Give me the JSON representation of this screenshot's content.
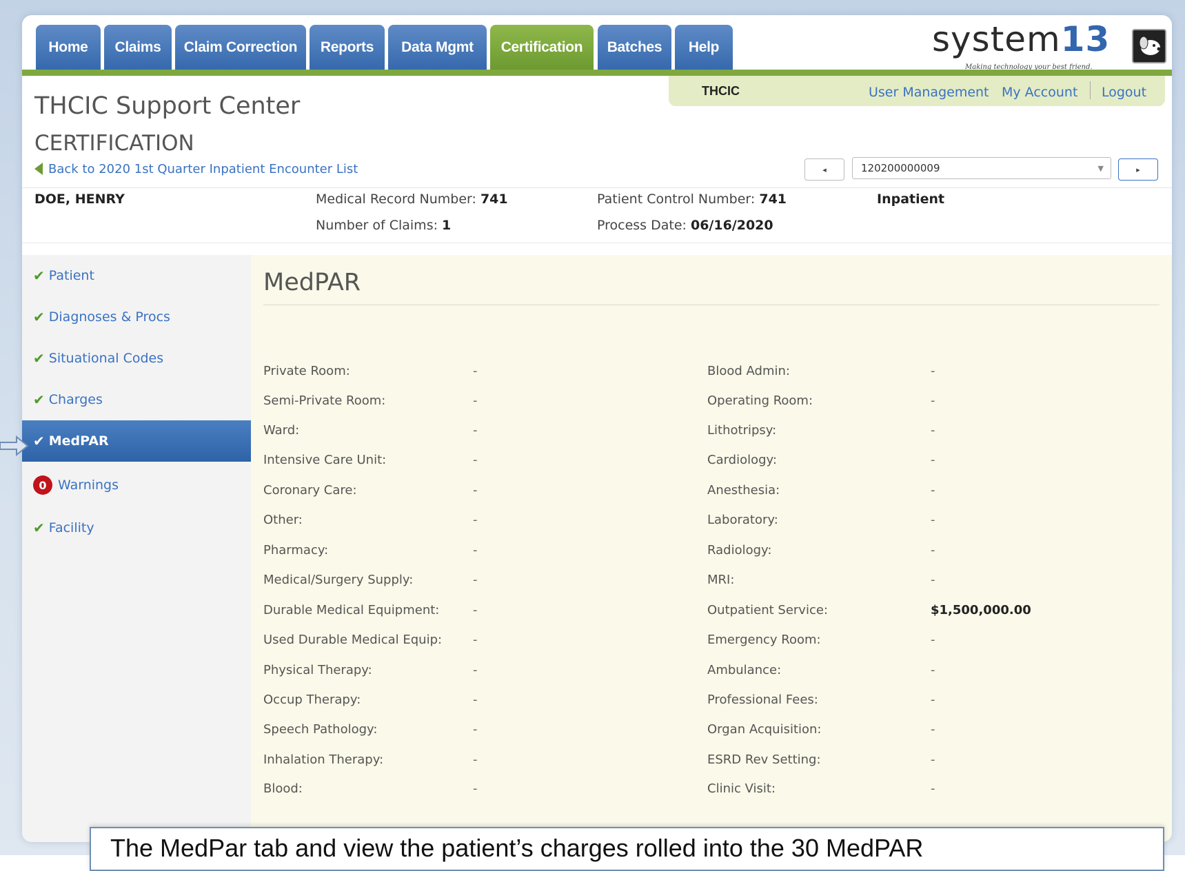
{
  "nav": {
    "tabs": [
      {
        "label": "Home"
      },
      {
        "label": "Claims"
      },
      {
        "label": "Claim Correction"
      },
      {
        "label": "Reports"
      },
      {
        "label": "Data Mgmt"
      },
      {
        "label": "Certification",
        "active": true
      },
      {
        "label": "Batches"
      },
      {
        "label": "Help"
      }
    ]
  },
  "logo": {
    "word_a": "system",
    "word_b": "13",
    "tagline": "Making technology your best friend."
  },
  "header": {
    "org": "THCIC",
    "links": {
      "user_management": "User Management",
      "my_account": "My Account",
      "logout": "Logout"
    },
    "app_title": "THCIC Support Center",
    "section_title": "CERTIFICATION",
    "back_link": "Back to 2020 1st Quarter Inpatient Encounter List"
  },
  "pager": {
    "prev_icon": "◂",
    "next_icon": "▸",
    "selected_claim": "120200000009",
    "caret_icon": "▼"
  },
  "patient": {
    "name": "DOE, HENRY",
    "mrn_label": "Medical Record Number: ",
    "mrn": "741",
    "claims_label": "Number of Claims: ",
    "claims": "1",
    "pcn_label": "Patient Control Number: ",
    "pcn": "741",
    "process_label": "Process Date: ",
    "process_date": "06/16/2020",
    "type": "Inpatient"
  },
  "sidebar": {
    "check_icon": "✔",
    "items": [
      {
        "label": "Patient"
      },
      {
        "label": "Diagnoses & Procs"
      },
      {
        "label": "Situational Codes"
      },
      {
        "label": "Charges"
      },
      {
        "label": "MedPAR",
        "active": true
      },
      {
        "label": "Warnings",
        "badge": "0"
      },
      {
        "label": "Facility"
      }
    ]
  },
  "main": {
    "title": "MedPAR",
    "left_fields": [
      {
        "label": "Private Room:",
        "value": "-"
      },
      {
        "label": "Semi-Private Room:",
        "value": "-"
      },
      {
        "label": "Ward:",
        "value": "-"
      },
      {
        "label": "Intensive Care Unit:",
        "value": "-"
      },
      {
        "label": "Coronary Care:",
        "value": "-"
      },
      {
        "label": "Other:",
        "value": "-"
      },
      {
        "label": "Pharmacy:",
        "value": "-"
      },
      {
        "label": "Medical/Surgery Supply:",
        "value": "-"
      },
      {
        "label": "Durable Medical Equipment:",
        "value": "-"
      },
      {
        "label": "Used Durable Medical Equip:",
        "value": "-"
      },
      {
        "label": "Physical Therapy:",
        "value": "-"
      },
      {
        "label": "Occup Therapy:",
        "value": "-"
      },
      {
        "label": "Speech Pathology:",
        "value": "-"
      },
      {
        "label": "Inhalation Therapy:",
        "value": "-"
      },
      {
        "label": "Blood:",
        "value": "-"
      }
    ],
    "right_fields": [
      {
        "label": "Blood Admin:",
        "value": "-"
      },
      {
        "label": "Operating Room:",
        "value": "-"
      },
      {
        "label": "Lithotripsy:",
        "value": "-"
      },
      {
        "label": "Cardiology:",
        "value": "-"
      },
      {
        "label": "Anesthesia:",
        "value": "-"
      },
      {
        "label": "Laboratory:",
        "value": "-"
      },
      {
        "label": "Radiology:",
        "value": "-"
      },
      {
        "label": "MRI:",
        "value": "-"
      },
      {
        "label": "Outpatient Service:",
        "value": "$1,500,000.00",
        "bold": true
      },
      {
        "label": "Emergency Room:",
        "value": "-"
      },
      {
        "label": "Ambulance:",
        "value": "-"
      },
      {
        "label": "Professional Fees:",
        "value": "-"
      },
      {
        "label": "Organ Acquisition:",
        "value": "-"
      },
      {
        "label": "ESRD Rev Setting:",
        "value": "-"
      },
      {
        "label": "Clinic Visit:",
        "value": "-"
      }
    ]
  },
  "caption": {
    "text": "The MedPar tab and view the patient’s charges rolled into the 30 MedPAR"
  },
  "colors": {
    "nav_blue": "#3569ad",
    "nav_green": "#6c9a31",
    "link": "#3a72c2",
    "content_bg": "#fbf9e9",
    "warning_red": "#c0131c"
  }
}
